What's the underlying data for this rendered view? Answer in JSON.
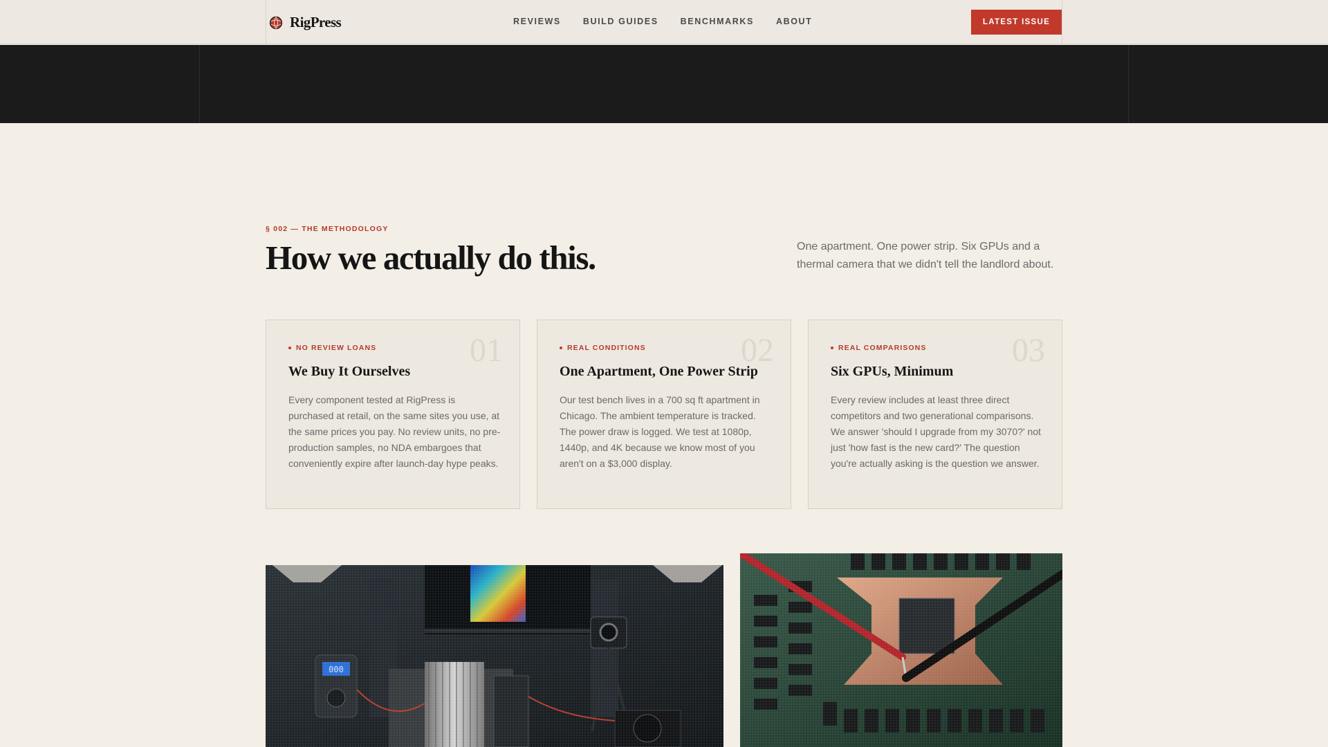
{
  "brand": {
    "name": "RigPress",
    "logo_icon": "globe-mark-icon",
    "accent": "#c0392b"
  },
  "nav": {
    "links": [
      "REVIEWS",
      "BUILD GUIDES",
      "BENCHMARKS",
      "ABOUT"
    ],
    "cta": "LATEST ISSUE"
  },
  "methodology": {
    "kicker": "§ 002 — THE METHODOLOGY",
    "headline": "How we actually do this.",
    "intro": "One apartment. One power strip. Six GPUs and a thermal camera that we didn't tell the landlord about.",
    "cards": [
      {
        "number": "01",
        "tag": "NO REVIEW LOANS",
        "title": "We Buy It Ourselves",
        "body": "Every component tested at RigPress is purchased at retail, on the same sites you use, at the same prices you pay. No review units, no pre-production samples, no NDA embargoes that conveniently expire after launch-day hype peaks."
      },
      {
        "number": "02",
        "tag": "REAL CONDITIONS",
        "title": "One Apartment, One Power Strip",
        "body": "Our test bench lives in a 700 sq ft apartment in Chicago. The ambient temperature is tracked. The power draw is logged. We test at 1080p, 1440p, and 4K because we know most of you aren't on a $3,000 display."
      },
      {
        "number": "03",
        "tag": "REAL COMPARISONS",
        "title": "Six GPUs, Minimum",
        "body": "Every review includes at least three direct competitors and two generational comparisons. We answer 'should I upgrade from my 3070?' not just 'how fast is the new card?' The question you're actually asking is the question we answer."
      }
    ]
  },
  "photos": {
    "left_readout": "000",
    "left_subject": "test-bench-photo",
    "right_subject": "gpu-probe-photo"
  }
}
